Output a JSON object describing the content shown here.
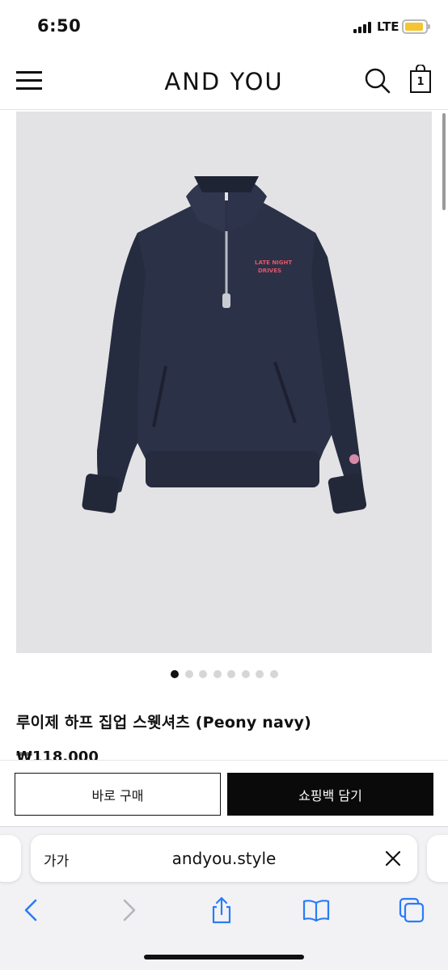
{
  "status_bar": {
    "time": "6:50",
    "network": "LTE"
  },
  "header": {
    "brand": "AND YOU",
    "cart_count": "1"
  },
  "product": {
    "name": "루이제 하프 집업 스웻셔츠 (Peony navy)",
    "price": "₩118,000",
    "print_text_line1": "LATE NIGHT",
    "print_text_line2": "DRIVES",
    "image_count": 8,
    "active_image": 1
  },
  "actions": {
    "buy_now": "바로 구매",
    "add_to_cart": "쇼핑백 담기"
  },
  "browser": {
    "text_size_label": "가가",
    "url": "andyou.style"
  },
  "colors": {
    "accent": "#0a0a0a",
    "product_navy": "#2a3147",
    "battery": "#f4c531"
  }
}
